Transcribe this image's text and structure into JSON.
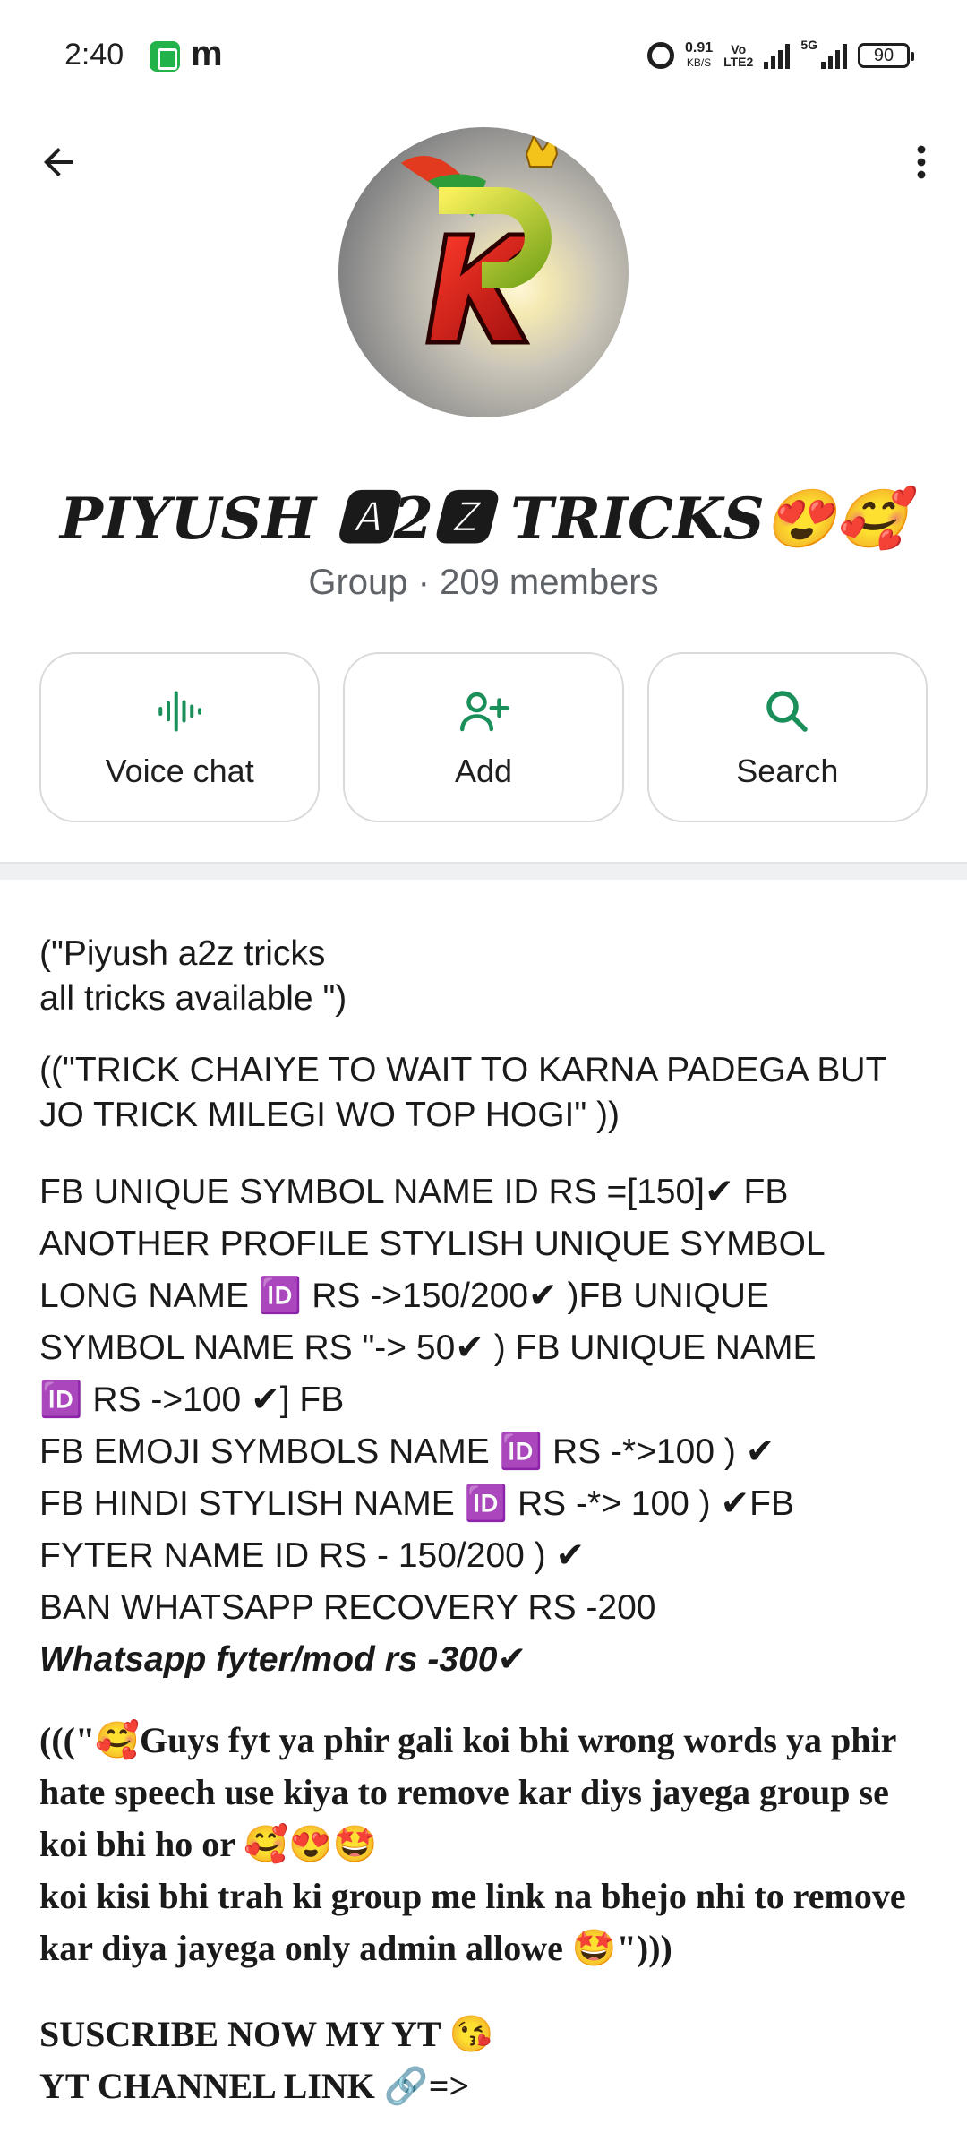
{
  "status_bar": {
    "time": "2:40",
    "app_letter": "m",
    "net_speed": "0.91",
    "net_unit": "KB/S",
    "volte_top": "Vo",
    "volte_bottom": "LTE2",
    "network": "5G",
    "battery": "90"
  },
  "header": {
    "back_icon": "arrow-left-icon",
    "more_icon": "more-vertical-icon"
  },
  "profile": {
    "avatar_letters": "DK",
    "name": "PIYUSH 🅰2🆉 TRICKS😍🥰",
    "subtitle": "Group · 209 members"
  },
  "actions": [
    {
      "label": "Voice chat",
      "icon": "voice-chat-icon"
    },
    {
      "label": "Add",
      "icon": "add-person-icon"
    },
    {
      "label": "Search",
      "icon": "search-icon"
    }
  ],
  "colors": {
    "accent": "#1a8f5a",
    "subtitle": "#5f6368",
    "card_border": "#d8dadc"
  },
  "description": {
    "p1": "(\"Piyush a2z tricks\n all tricks available \")",
    "p2": "((\"TRICK CHAIYE TO WAIT TO KARNA PADEGA BUT JO TRICK MILEGI WO TOP HOGI\" ))",
    "p3_lines": [
      "FB UNIQUE SYMBOL NAME ID RS =[150]✔ FB",
      "ANOTHER PROFILE STYLISH UNIQUE SYMBOL",
      "LONG NAME 🆔 RS ->150/200✔ )FB UNIQUE",
      "SYMBOL NAME RS \"-> 50✔ ) FB  UNIQUE  NAME",
      "🆔 RS ->100 ✔] FB",
      "FB EMOJI SYMBOLS NAME  🆔      RS -*>100 ) ✔",
      "FB HINDI STYLISH NAME 🆔 RS -*> 100 ) ✔FB",
      "FYTER NAME ID RS - 150/200 ) ✔",
      "BAN WHATSAPP RECOVERY RS -200",
      "Whatsapp fyter/mod rs -300✔"
    ],
    "p4": "(((\"🥰Guys fyt ya phir gali koi bhi wrong  words ya phir hate speech use kiya to remove kar diys jayega group se koi bhi ho or 🥰😍🤩\nkoi kisi bhi trah ki group me link na bhejo nhi to remove kar diya jayega only admin allowe 🤩\")))",
    "p5": "SUSCRIBE NOW MY YT 😘\nYT CHANNEL LINK 🔗=>"
  }
}
